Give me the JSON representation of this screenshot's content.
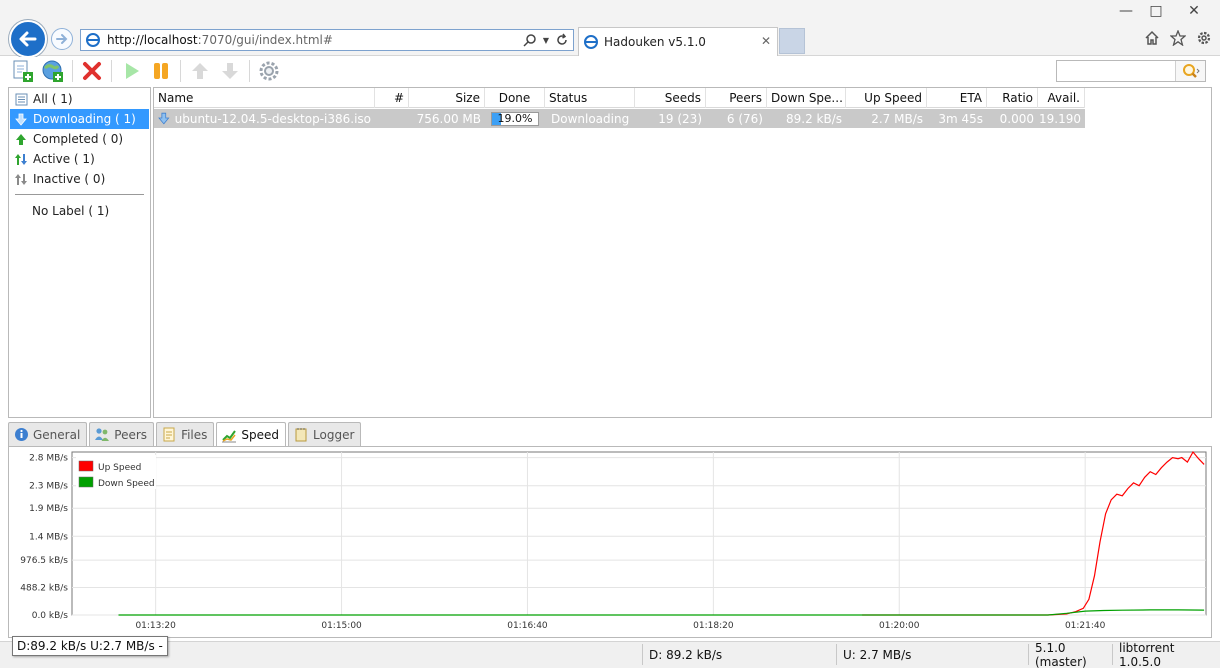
{
  "browser": {
    "url_host": "http://localhost",
    "url_rest": ":7070/gui/index.html#",
    "tab_title": "Hadouken v5.1.0"
  },
  "sidebar": {
    "filters": [
      {
        "label": "All ( 1)",
        "icon": "list-icon"
      },
      {
        "label": "Downloading ( 1)",
        "icon": "arrow-down-icon"
      },
      {
        "label": "Completed ( 0)",
        "icon": "arrow-up-green-icon"
      },
      {
        "label": "Active ( 1)",
        "icon": "arrows-updown-icon"
      },
      {
        "label": "Inactive ( 0)",
        "icon": "arrows-updown-grey-icon"
      }
    ],
    "labels": [
      {
        "label": "No Label ( 1)"
      }
    ]
  },
  "torrents": {
    "columns": [
      "Name",
      "#",
      "Size",
      "Done",
      "Status",
      "Seeds",
      "Peers",
      "Down Spe...",
      "Up Speed",
      "ETA",
      "Ratio",
      "Avail."
    ],
    "rows": [
      {
        "name": "ubuntu-12.04.5-desktop-i386.iso",
        "queue": "",
        "size": "756.00 MB",
        "done": "19.0%",
        "done_fraction": 0.19,
        "status": "Downloading",
        "seeds": "19 (23)",
        "peers": "6 (76)",
        "down_speed": "89.2 kB/s",
        "up_speed": "2.7 MB/s",
        "eta": "3m 45s",
        "ratio": "0.000",
        "avail": "19.190"
      }
    ]
  },
  "detail_tabs": [
    "General",
    "Peers",
    "Files",
    "Speed",
    "Logger"
  ],
  "chart_data": {
    "type": "line",
    "y_tick_labels": [
      "2.8 MB/s",
      "2.3 MB/s",
      "1.9 MB/s",
      "1.4 MB/s",
      "976.5 kB/s",
      "488.2 kB/s",
      "0.0 kB/s"
    ],
    "y_tick_values": [
      2.8,
      2.3,
      1.9,
      1.4,
      0.9765,
      0.4882,
      0.0
    ],
    "x_tick_labels": [
      "01:13:20",
      "01:15:00",
      "01:16:40",
      "01:18:20",
      "01:20:00",
      "01:21:40"
    ],
    "x_tick_seconds": [
      4400,
      4500,
      4600,
      4700,
      4800,
      4900
    ],
    "x_range_seconds": [
      4355,
      4965
    ],
    "ylim": [
      0,
      2.9
    ],
    "grid": true,
    "legend_position": "top-left",
    "series": [
      {
        "name": "Up Speed",
        "color": "#ff0000",
        "x": [
          4780,
          4880,
          4890,
          4895,
          4899,
          4902,
          4905,
          4908,
          4911,
          4914,
          4917,
          4920,
          4923,
          4926,
          4929,
          4932,
          4935,
          4938,
          4941,
          4944,
          4947,
          4950,
          4952,
          4955,
          4958,
          4961,
          4964
        ],
        "y": [
          0.0,
          0.0,
          0.02,
          0.06,
          0.12,
          0.28,
          0.7,
          1.3,
          1.8,
          2.05,
          2.15,
          2.12,
          2.25,
          2.35,
          2.3,
          2.45,
          2.55,
          2.5,
          2.62,
          2.72,
          2.8,
          2.78,
          2.8,
          2.72,
          2.9,
          2.78,
          2.68
        ]
      },
      {
        "name": "Down Speed",
        "color": "#00a000",
        "x": [
          4380,
          4880,
          4890,
          4900,
          4910,
          4920,
          4935,
          4950,
          4964
        ],
        "y": [
          0.0,
          0.0,
          0.03,
          0.07,
          0.08,
          0.085,
          0.09,
          0.09,
          0.088
        ]
      }
    ]
  },
  "statusbar": {
    "tooltip": "D:89.2 kB/s U:2.7 MB/s -",
    "down": "D: 89.2 kB/s",
    "up": "U: 2.7 MB/s",
    "version": "5.1.0 (master)",
    "lib": "libtorrent 1.0.5.0"
  }
}
